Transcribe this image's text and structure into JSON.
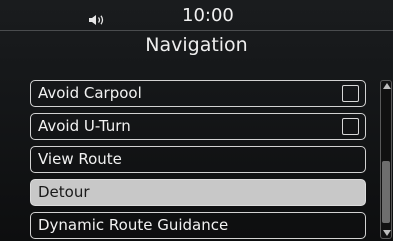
{
  "status_bar": {
    "time": "10:00",
    "volume_icon": "speaker-icon"
  },
  "header": {
    "title": "Navigation"
  },
  "menu": {
    "items": [
      {
        "label": "Avoid Carpool",
        "has_checkbox": true,
        "checked": false,
        "selected": false
      },
      {
        "label": "Avoid U-Turn",
        "has_checkbox": true,
        "checked": false,
        "selected": false
      },
      {
        "label": "View Route",
        "has_checkbox": false,
        "selected": false
      },
      {
        "label": "Detour",
        "has_checkbox": false,
        "selected": true
      },
      {
        "label": "Dynamic Route Guidance",
        "has_checkbox": false,
        "selected": false
      }
    ]
  },
  "colors": {
    "background": "#16181a",
    "row_border": "#d2d2d2",
    "selected_row": "#c8c8c8",
    "text": "#f2f2f2"
  }
}
